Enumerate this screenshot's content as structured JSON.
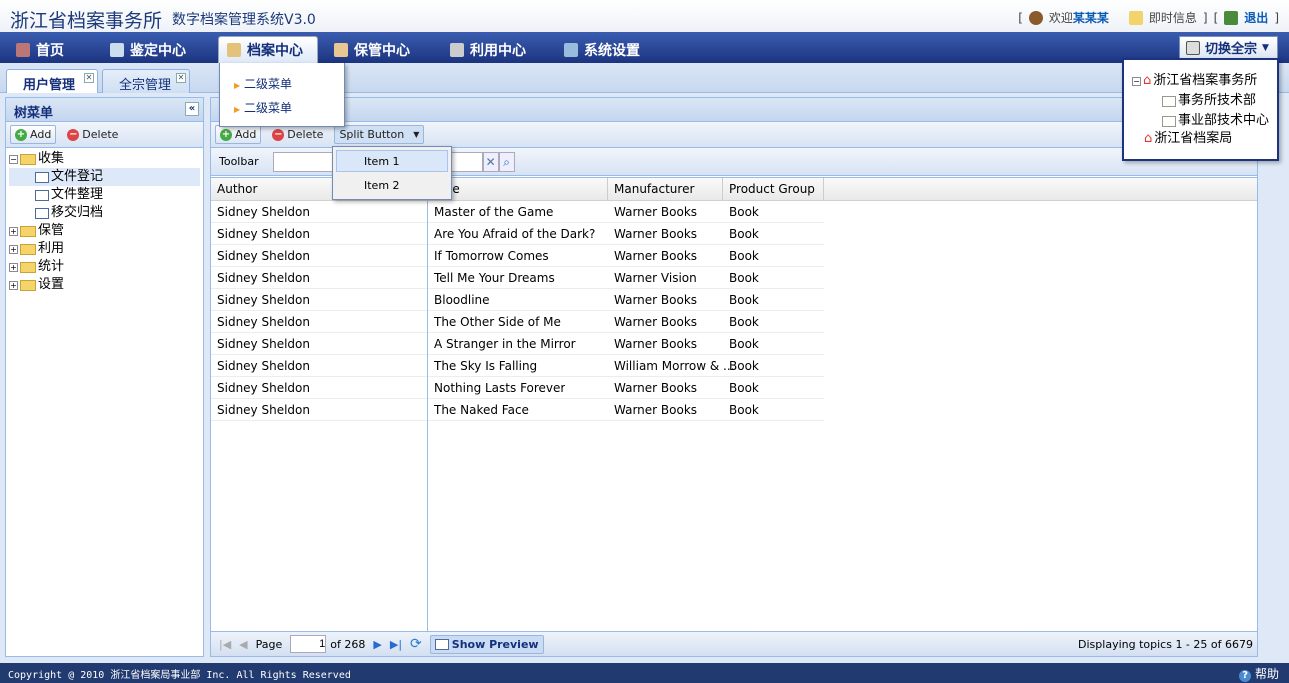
{
  "header": {
    "title": "浙江省档案事务所",
    "subtitle": "数字档案管理系统V3.0",
    "welcome": "欢迎",
    "user": "某某某",
    "messages": "即时信息",
    "logout": "退出"
  },
  "nav": {
    "items": [
      {
        "label": "首页"
      },
      {
        "label": "鉴定中心"
      },
      {
        "label": "档案中心"
      },
      {
        "label": "保管中心"
      },
      {
        "label": "利用中心"
      },
      {
        "label": "系统设置"
      }
    ],
    "submenu": [
      "二级菜单",
      "二级菜单"
    ],
    "switch_label": "切换全宗"
  },
  "switch_tree": [
    {
      "label": "浙江省档案事务所",
      "children": [
        "事务所技术部",
        "事业部技术中心"
      ]
    },
    {
      "label": "浙江省档案局"
    }
  ],
  "tabs": [
    {
      "label": "用户管理"
    },
    {
      "label": "全宗管理"
    }
  ],
  "left": {
    "title": "树菜单",
    "add": "Add",
    "delete": "Delete",
    "tree": [
      {
        "label": "收集",
        "children": [
          "文件登记",
          "文件整理",
          "移交归档"
        ]
      },
      {
        "label": "保管"
      },
      {
        "label": "利用"
      },
      {
        "label": "统计"
      },
      {
        "label": "设置"
      }
    ]
  },
  "main": {
    "add": "Add",
    "delete": "Delete",
    "split": "Split Button",
    "split_items": [
      "Item 1",
      "Item 2"
    ],
    "toolbar_label": "Toolbar",
    "search_value": "",
    "columns": [
      "Author",
      "Title",
      "Manufacturer",
      "Product Group"
    ],
    "rows": [
      [
        "Sidney Sheldon",
        "Master of the Game",
        "Warner Books",
        "Book"
      ],
      [
        "Sidney Sheldon",
        "Are You Afraid of the Dark?",
        "Warner Books",
        "Book"
      ],
      [
        "Sidney Sheldon",
        "If Tomorrow Comes",
        "Warner Books",
        "Book"
      ],
      [
        "Sidney Sheldon",
        "Tell Me Your Dreams",
        "Warner Vision",
        "Book"
      ],
      [
        "Sidney Sheldon",
        "Bloodline",
        "Warner Books",
        "Book"
      ],
      [
        "Sidney Sheldon",
        "The Other Side of Me",
        "Warner Books",
        "Book"
      ],
      [
        "Sidney Sheldon",
        "A Stranger in the Mirror",
        "Warner Books",
        "Book"
      ],
      [
        "Sidney Sheldon",
        "The Sky Is Falling",
        "William Morrow & ...",
        "Book"
      ],
      [
        "Sidney Sheldon",
        "Nothing Lasts Forever",
        "Warner Books",
        "Book"
      ],
      [
        "Sidney Sheldon",
        "The Naked Face",
        "Warner Books",
        "Book"
      ]
    ],
    "paging": {
      "page_label": "Page",
      "page": "1",
      "of": "of 268",
      "preview": "Show Preview",
      "display": "Displaying topics 1 - 25 of 6679"
    }
  },
  "footer": {
    "copyright": "Copyright @ 2010 浙江省档案局事业部 Inc. All Rights Reserved",
    "help": "帮助"
  }
}
